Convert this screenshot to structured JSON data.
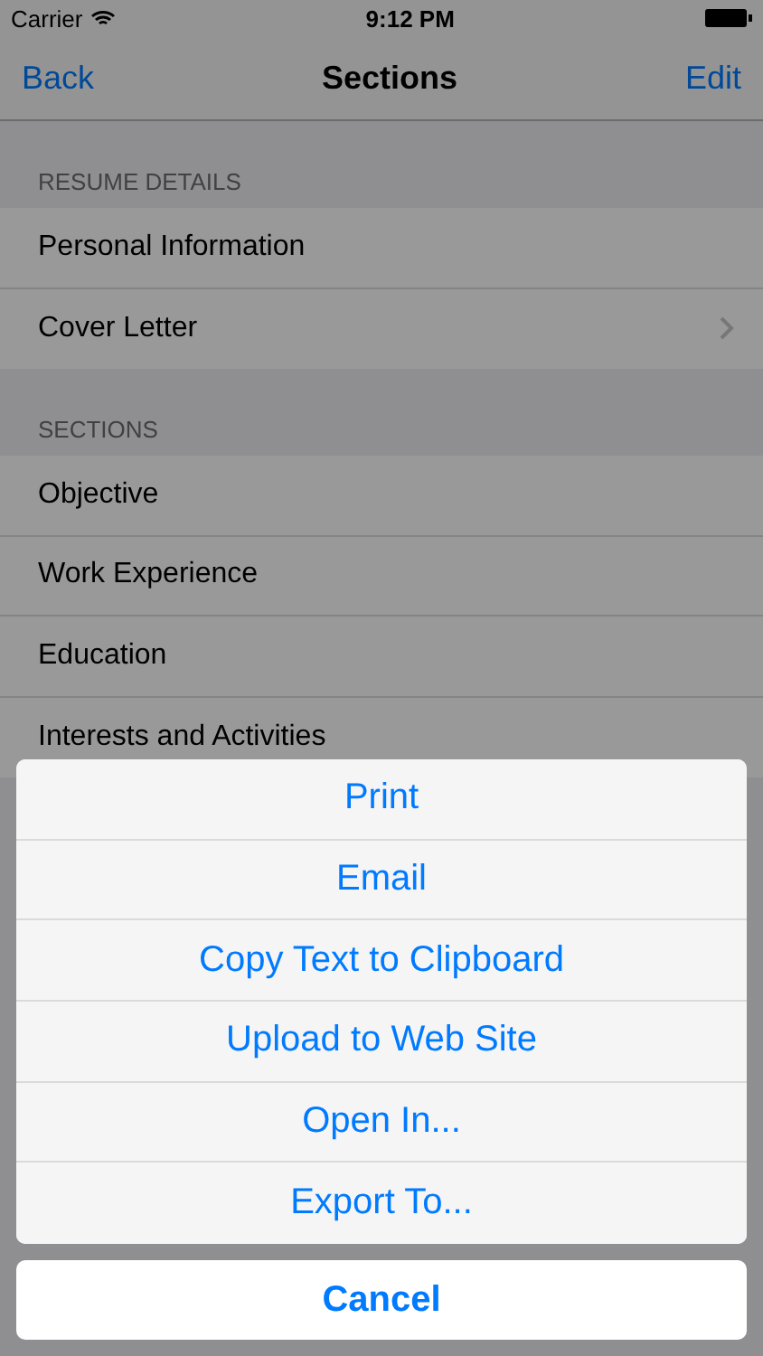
{
  "status_bar": {
    "carrier": "Carrier",
    "time": "9:12 PM"
  },
  "nav": {
    "back": "Back",
    "title": "Sections",
    "action": "Edit"
  },
  "groups": [
    {
      "header": "RESUME DETAILS",
      "rows": [
        {
          "label": "Personal Information",
          "disclosure": false
        },
        {
          "label": "Cover Letter",
          "disclosure": true
        }
      ]
    },
    {
      "header": "SECTIONS",
      "rows": [
        {
          "label": "Objective",
          "disclosure": false
        },
        {
          "label": "Work Experience",
          "disclosure": false
        },
        {
          "label": "Education",
          "disclosure": false
        },
        {
          "label": "Interests and Activities",
          "disclosure": false
        }
      ]
    }
  ],
  "action_sheet": {
    "actions": [
      "Print",
      "Email",
      "Copy Text to Clipboard",
      "Upload to Web Site",
      "Open In...",
      "Export To..."
    ],
    "cancel": "Cancel"
  }
}
